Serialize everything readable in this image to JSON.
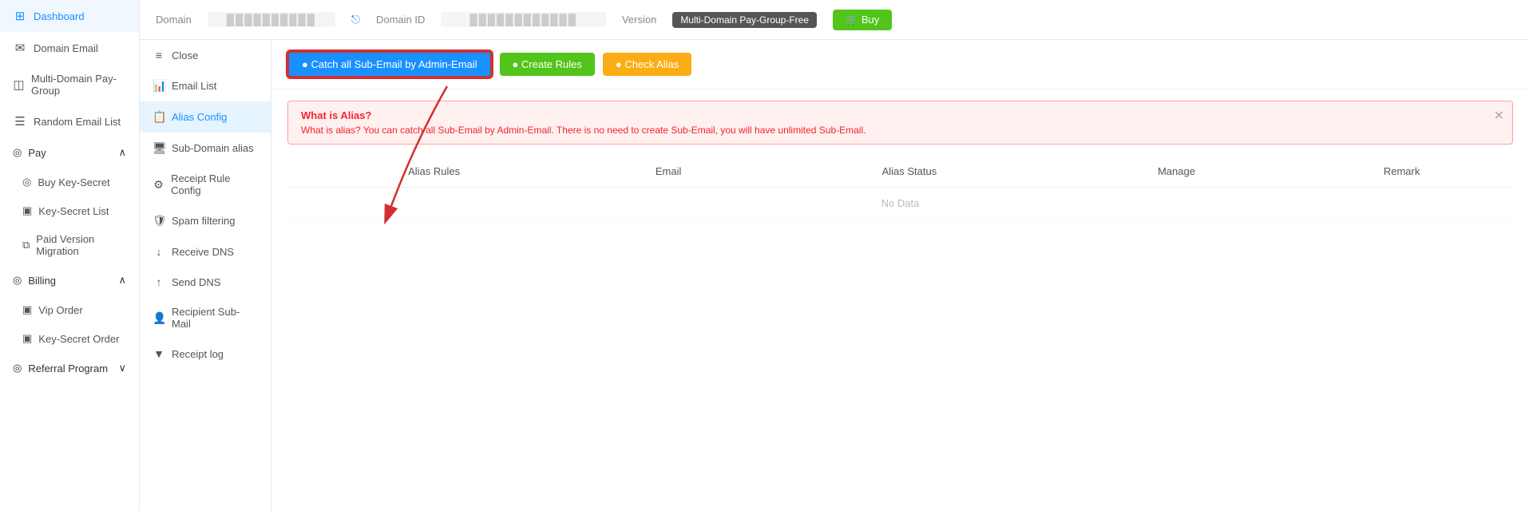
{
  "sidebar": {
    "items": [
      {
        "id": "dashboard",
        "label": "Dashboard",
        "icon": "⊞"
      },
      {
        "id": "domain-email",
        "label": "Domain Email",
        "icon": "✉"
      },
      {
        "id": "multi-domain",
        "label": "Multi-Domain Pay-Group",
        "icon": "◫"
      },
      {
        "id": "random-email",
        "label": "Random Email List",
        "icon": "☰"
      }
    ],
    "pay_group": {
      "label": "Pay",
      "items": [
        {
          "id": "buy-key-secret",
          "label": "Buy Key-Secret",
          "icon": "◎"
        },
        {
          "id": "key-secret-list",
          "label": "Key-Secret List",
          "icon": "▣"
        },
        {
          "id": "paid-version",
          "label": "Paid Version Migration",
          "icon": "⧉"
        }
      ]
    },
    "billing_group": {
      "label": "Billing",
      "items": [
        {
          "id": "vip-order",
          "label": "Vip Order",
          "icon": "▣"
        },
        {
          "id": "key-secret-order",
          "label": "Key-Secret Order",
          "icon": "▣"
        }
      ]
    },
    "referral": {
      "label": "Referral Program"
    }
  },
  "header": {
    "domain_label": "Domain",
    "domain_value": "••••••••••",
    "domain_id_label": "Domain ID",
    "domain_id_value": "••••••••••••",
    "version_label": "Version",
    "version_value": "Multi-Domain Pay-Group-Free",
    "buy_label": "🛒 Buy"
  },
  "panel_sidebar": {
    "items": [
      {
        "id": "close",
        "label": "Close",
        "icon": "≡",
        "active": false
      },
      {
        "id": "email-list",
        "label": "Email List",
        "icon": "📊",
        "active": false
      },
      {
        "id": "alias-config",
        "label": "Alias Config",
        "icon": "📋",
        "active": true
      },
      {
        "id": "sub-domain-alias",
        "label": "Sub-Domain alias",
        "icon": "🖥",
        "active": false
      },
      {
        "id": "receipt-rule",
        "label": "Receipt Rule Config",
        "icon": "⚙",
        "active": false
      },
      {
        "id": "spam-filtering",
        "label": "Spam filtering",
        "icon": "🛡",
        "active": false
      },
      {
        "id": "receive-dns",
        "label": "Receive DNS",
        "icon": "↓",
        "active": false
      },
      {
        "id": "send-dns",
        "label": "Send DNS",
        "icon": "↑",
        "active": false
      },
      {
        "id": "recipient-sub-mail",
        "label": "Recipient Sub-Mail",
        "icon": "👤",
        "active": false
      },
      {
        "id": "receipt-log",
        "label": "Receipt log",
        "icon": "▼",
        "active": false
      }
    ]
  },
  "toolbar": {
    "catch_btn": "● Catch all Sub-Email by Admin-Email",
    "create_btn": "● Create Rules",
    "check_btn": "● Check Alias"
  },
  "info_banner": {
    "title": "What is Alias?",
    "text": "What is alias? You can catch all Sub-Email by Admin-Email. There is no need to create Sub-Email, you will have unlimited Sub-Email."
  },
  "table": {
    "columns": [
      "Alias Rules",
      "Email",
      "Alias Status",
      "Manage",
      "Remark"
    ],
    "no_data": "No Data"
  }
}
